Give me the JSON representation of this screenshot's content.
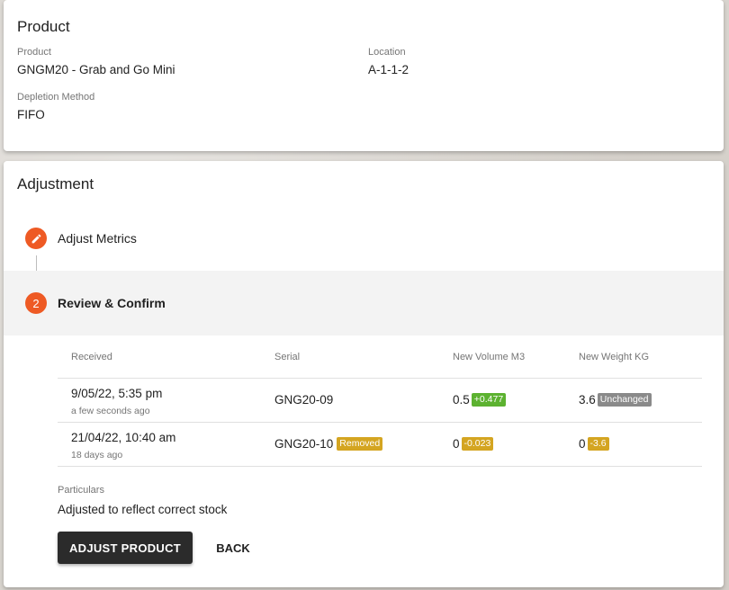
{
  "product_card": {
    "title": "Product",
    "product_label": "Product",
    "product_value": "GNGM20 - Grab and Go Mini",
    "location_label": "Location",
    "location_value": "A-1-1-2",
    "depletion_label": "Depletion Method",
    "depletion_value": "FIFO"
  },
  "adjustment_card": {
    "title": "Adjustment",
    "steps": [
      {
        "icon": "pencil-icon",
        "label": "Adjust Metrics"
      },
      {
        "number": "2",
        "label": "Review & Confirm"
      }
    ],
    "table": {
      "headers": [
        "Received",
        "Serial",
        "New Volume M3",
        "New Weight KG"
      ],
      "rows": [
        {
          "received": "9/05/22, 5:35 pm",
          "received_relative": "a few seconds ago",
          "serial": "GNG20-09",
          "serial_badge": "",
          "volume": "0.5",
          "volume_badge": "+0.477",
          "weight": "3.6",
          "weight_badge": "Unchanged"
        },
        {
          "received": "21/04/22, 10:40 am",
          "received_relative": "18 days ago",
          "serial": "GNG20-10",
          "serial_badge": "Removed",
          "volume": "0",
          "volume_badge": "-0.023",
          "weight": "0",
          "weight_badge": "-3.6"
        }
      ]
    },
    "particulars_label": "Particulars",
    "particulars_value": "Adjusted to reflect correct stock",
    "adjust_button": "ADJUST PRODUCT",
    "back_button": "BACK"
  },
  "colors": {
    "accent": "#ee5a24",
    "badge_positive": "#5cb230",
    "badge_warning": "#d4a521",
    "badge_neutral": "#8a8a8a",
    "button_dark": "#2b2b2b"
  }
}
